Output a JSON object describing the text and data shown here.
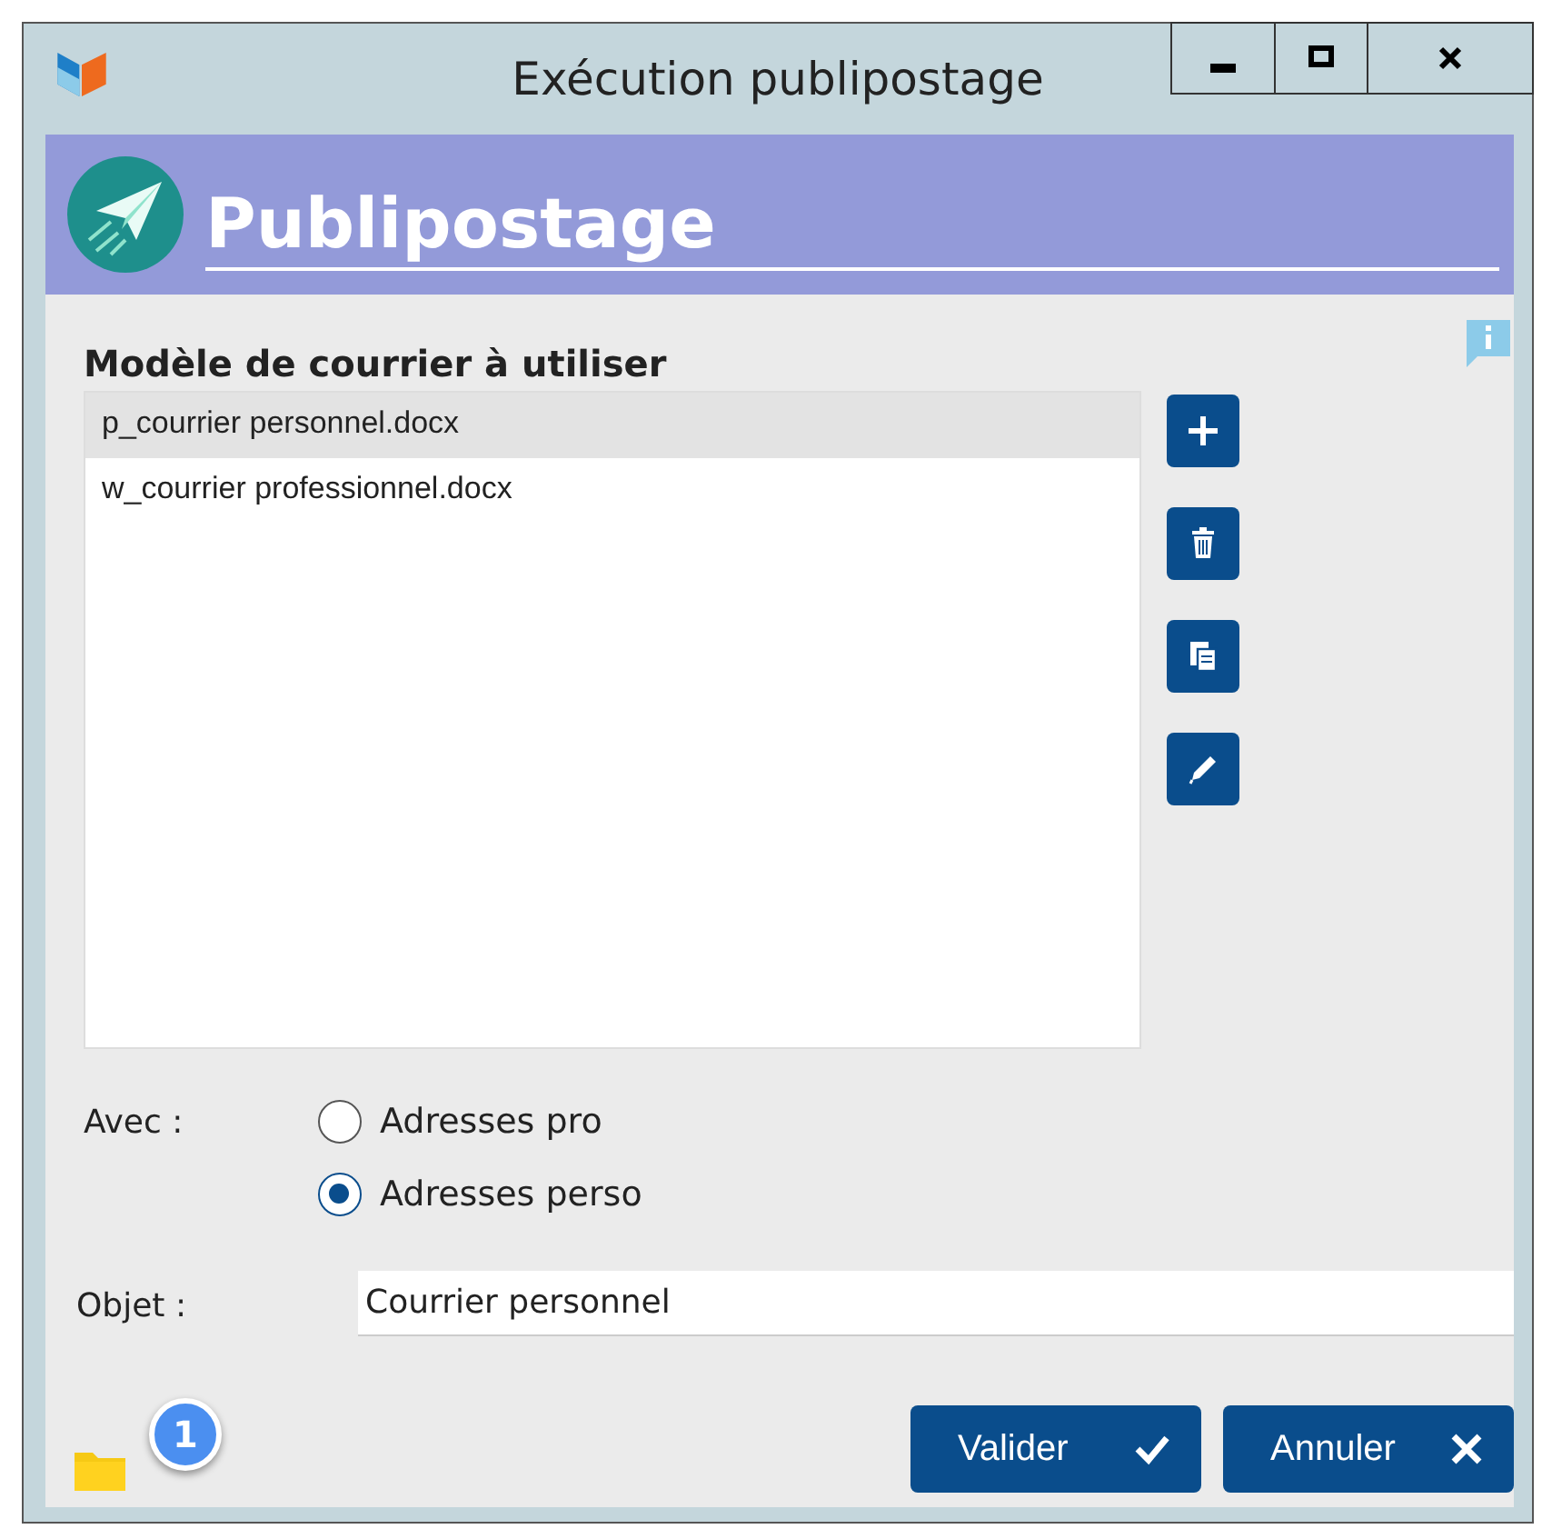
{
  "window": {
    "title": "Exécution publipostage"
  },
  "header": {
    "title": "Publipostage"
  },
  "templates": {
    "label": "Modèle de courrier à utiliser",
    "items": [
      {
        "name": "p_courrier personnel.docx",
        "selected": true
      },
      {
        "name": "w_courrier professionnel.docx",
        "selected": false
      }
    ]
  },
  "with": {
    "label": "Avec :",
    "options": [
      {
        "label": "Adresses pro",
        "selected": false
      },
      {
        "label": "Adresses perso",
        "selected": true
      }
    ]
  },
  "subject": {
    "label": "Objet :",
    "value": "Courrier personnel"
  },
  "footer": {
    "badge": "1",
    "buttons": [
      {
        "label": "Valider",
        "kind": "confirm"
      },
      {
        "label": "Annuler",
        "kind": "cancel"
      }
    ]
  }
}
